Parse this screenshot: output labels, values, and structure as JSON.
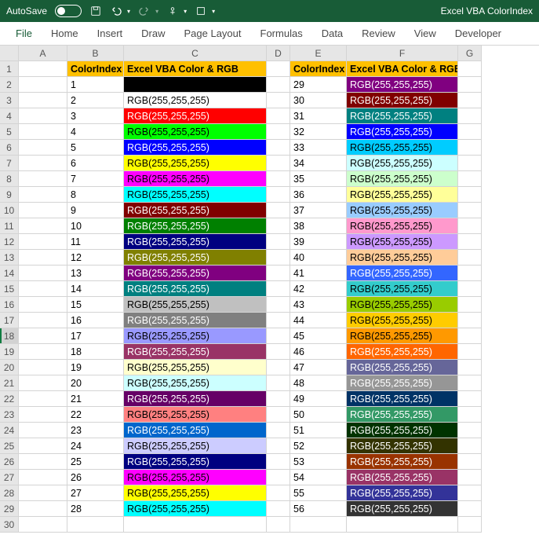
{
  "titlebar": {
    "autosave_label": "AutoSave",
    "autosave_state": "Off",
    "doc_title": "Excel VBA ColorIndex"
  },
  "ribbon": {
    "tabs": [
      "File",
      "Home",
      "Insert",
      "Draw",
      "Page Layout",
      "Formulas",
      "Data",
      "Review",
      "View",
      "Developer"
    ]
  },
  "columns": [
    "A",
    "B",
    "C",
    "D",
    "E",
    "F",
    "G"
  ],
  "row_count": 30,
  "selected_row": 18,
  "headers": {
    "b1": "ColorIndex",
    "c1": "Excel VBA Color & RGB",
    "e1": "ColorIndex",
    "f1": "Excel VBA Color & RGB"
  },
  "chart_data": {
    "type": "table",
    "description": "Excel VBA ColorIndex palette mapping ColorIndex numbers 1-56 to their fill colors with RGB text",
    "rows": [
      {
        "row": 2,
        "idx": 1,
        "text": "",
        "bg": "#000000",
        "fg": "#000000",
        "idx2": 29,
        "text2": "RGB(255,255,255)",
        "bg2": "#800080",
        "fg2": "#ffffff"
      },
      {
        "row": 3,
        "idx": 2,
        "text": "RGB(255,255,255)",
        "bg": "#ffffff",
        "fg": "#000000",
        "idx2": 30,
        "text2": "RGB(255,255,255)",
        "bg2": "#800000",
        "fg2": "#ffffff"
      },
      {
        "row": 4,
        "idx": 3,
        "text": "RGB(255,255,255)",
        "bg": "#ff0000",
        "fg": "#ffffff",
        "idx2": 31,
        "text2": "RGB(255,255,255)",
        "bg2": "#008080",
        "fg2": "#ffffff"
      },
      {
        "row": 5,
        "idx": 4,
        "text": "RGB(255,255,255)",
        "bg": "#00ff00",
        "fg": "#000000",
        "idx2": 32,
        "text2": "RGB(255,255,255)",
        "bg2": "#0000ff",
        "fg2": "#ffffff"
      },
      {
        "row": 6,
        "idx": 5,
        "text": "RGB(255,255,255)",
        "bg": "#0000ff",
        "fg": "#ffffff",
        "idx2": 33,
        "text2": "RGB(255,255,255)",
        "bg2": "#00ccff",
        "fg2": "#000000"
      },
      {
        "row": 7,
        "idx": 6,
        "text": "RGB(255,255,255)",
        "bg": "#ffff00",
        "fg": "#000000",
        "idx2": 34,
        "text2": "RGB(255,255,255)",
        "bg2": "#ccffff",
        "fg2": "#000000"
      },
      {
        "row": 8,
        "idx": 7,
        "text": "RGB(255,255,255)",
        "bg": "#ff00ff",
        "fg": "#000000",
        "idx2": 35,
        "text2": "RGB(255,255,255)",
        "bg2": "#ccffcc",
        "fg2": "#000000"
      },
      {
        "row": 9,
        "idx": 8,
        "text": "RGB(255,255,255)",
        "bg": "#00ffff",
        "fg": "#000000",
        "idx2": 36,
        "text2": "RGB(255,255,255)",
        "bg2": "#ffff99",
        "fg2": "#000000"
      },
      {
        "row": 10,
        "idx": 9,
        "text": "RGB(255,255,255)",
        "bg": "#800000",
        "fg": "#ffffff",
        "idx2": 37,
        "text2": "RGB(255,255,255)",
        "bg2": "#99ccff",
        "fg2": "#000000"
      },
      {
        "row": 11,
        "idx": 10,
        "text": "RGB(255,255,255)",
        "bg": "#008000",
        "fg": "#ffffff",
        "idx2": 38,
        "text2": "RGB(255,255,255)",
        "bg2": "#ff99cc",
        "fg2": "#000000"
      },
      {
        "row": 12,
        "idx": 11,
        "text": "RGB(255,255,255)",
        "bg": "#000080",
        "fg": "#ffffff",
        "idx2": 39,
        "text2": "RGB(255,255,255)",
        "bg2": "#cc99ff",
        "fg2": "#000000"
      },
      {
        "row": 13,
        "idx": 12,
        "text": "RGB(255,255,255)",
        "bg": "#808000",
        "fg": "#ffffff",
        "idx2": 40,
        "text2": "RGB(255,255,255)",
        "bg2": "#ffcc99",
        "fg2": "#000000"
      },
      {
        "row": 14,
        "idx": 13,
        "text": "RGB(255,255,255)",
        "bg": "#800080",
        "fg": "#ffffff",
        "idx2": 41,
        "text2": "RGB(255,255,255)",
        "bg2": "#3366ff",
        "fg2": "#ffffff"
      },
      {
        "row": 15,
        "idx": 14,
        "text": "RGB(255,255,255)",
        "bg": "#008080",
        "fg": "#ffffff",
        "idx2": 42,
        "text2": "RGB(255,255,255)",
        "bg2": "#33cccc",
        "fg2": "#000000"
      },
      {
        "row": 16,
        "idx": 15,
        "text": "RGB(255,255,255)",
        "bg": "#c0c0c0",
        "fg": "#000000",
        "idx2": 43,
        "text2": "RGB(255,255,255)",
        "bg2": "#99cc00",
        "fg2": "#000000"
      },
      {
        "row": 17,
        "idx": 16,
        "text": "RGB(255,255,255)",
        "bg": "#808080",
        "fg": "#ffffff",
        "idx2": 44,
        "text2": "RGB(255,255,255)",
        "bg2": "#ffcc00",
        "fg2": "#000000"
      },
      {
        "row": 18,
        "idx": 17,
        "text": "RGB(255,255,255)",
        "bg": "#9999ff",
        "fg": "#000000",
        "idx2": 45,
        "text2": "RGB(255,255,255)",
        "bg2": "#ff9900",
        "fg2": "#000000"
      },
      {
        "row": 19,
        "idx": 18,
        "text": "RGB(255,255,255)",
        "bg": "#993366",
        "fg": "#ffffff",
        "idx2": 46,
        "text2": "RGB(255,255,255)",
        "bg2": "#ff6600",
        "fg2": "#ffffff"
      },
      {
        "row": 20,
        "idx": 19,
        "text": "RGB(255,255,255)",
        "bg": "#ffffcc",
        "fg": "#000000",
        "idx2": 47,
        "text2": "RGB(255,255,255)",
        "bg2": "#666699",
        "fg2": "#ffffff"
      },
      {
        "row": 21,
        "idx": 20,
        "text": "RGB(255,255,255)",
        "bg": "#ccffff",
        "fg": "#000000",
        "idx2": 48,
        "text2": "RGB(255,255,255)",
        "bg2": "#969696",
        "fg2": "#ffffff"
      },
      {
        "row": 22,
        "idx": 21,
        "text": "RGB(255,255,255)",
        "bg": "#660066",
        "fg": "#ffffff",
        "idx2": 49,
        "text2": "RGB(255,255,255)",
        "bg2": "#003366",
        "fg2": "#ffffff"
      },
      {
        "row": 23,
        "idx": 22,
        "text": "RGB(255,255,255)",
        "bg": "#ff8080",
        "fg": "#000000",
        "idx2": 50,
        "text2": "RGB(255,255,255)",
        "bg2": "#339966",
        "fg2": "#ffffff"
      },
      {
        "row": 24,
        "idx": 23,
        "text": "RGB(255,255,255)",
        "bg": "#0066cc",
        "fg": "#ffffff",
        "idx2": 51,
        "text2": "RGB(255,255,255)",
        "bg2": "#003300",
        "fg2": "#ffffff"
      },
      {
        "row": 25,
        "idx": 24,
        "text": "RGB(255,255,255)",
        "bg": "#ccccff",
        "fg": "#000000",
        "idx2": 52,
        "text2": "RGB(255,255,255)",
        "bg2": "#333300",
        "fg2": "#ffffff"
      },
      {
        "row": 26,
        "idx": 25,
        "text": "RGB(255,255,255)",
        "bg": "#000080",
        "fg": "#ffffff",
        "idx2": 53,
        "text2": "RGB(255,255,255)",
        "bg2": "#993300",
        "fg2": "#ffffff"
      },
      {
        "row": 27,
        "idx": 26,
        "text": "RGB(255,255,255)",
        "bg": "#ff00ff",
        "fg": "#000000",
        "idx2": 54,
        "text2": "RGB(255,255,255)",
        "bg2": "#993366",
        "fg2": "#ffffff"
      },
      {
        "row": 28,
        "idx": 27,
        "text": "RGB(255,255,255)",
        "bg": "#ffff00",
        "fg": "#000000",
        "idx2": 55,
        "text2": "RGB(255,255,255)",
        "bg2": "#333399",
        "fg2": "#ffffff"
      },
      {
        "row": 29,
        "idx": 28,
        "text": "RGB(255,255,255)",
        "bg": "#00ffff",
        "fg": "#000000",
        "idx2": 56,
        "text2": "RGB(255,255,255)",
        "bg2": "#333333",
        "fg2": "#ffffff"
      }
    ]
  }
}
